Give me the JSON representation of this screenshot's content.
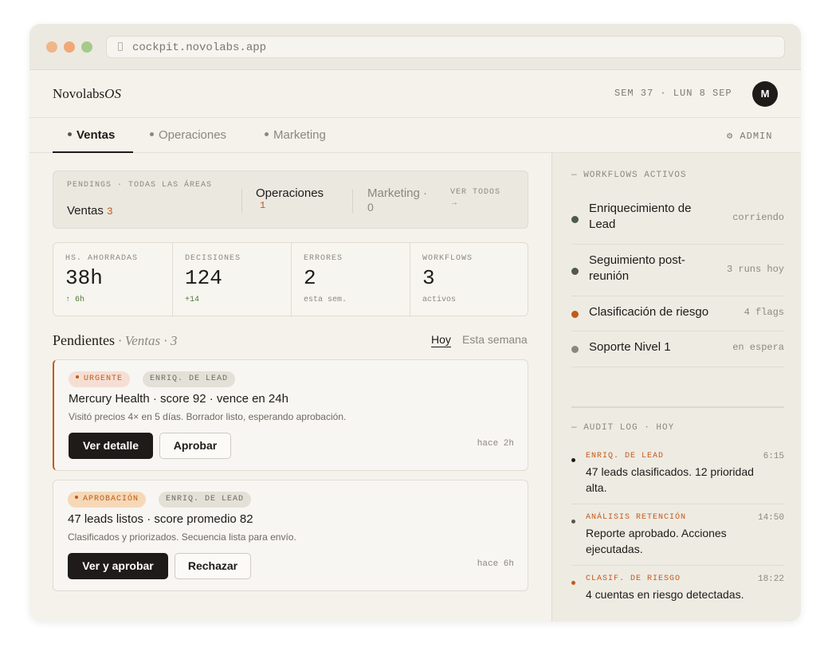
{
  "browser": {
    "url": "cockpit.novolabs.app"
  },
  "header": {
    "brand_main": "Novolabs",
    "brand_italic": "OS",
    "date": "SEM 37 · LUN 8 SEP",
    "avatar": "M"
  },
  "tabs": [
    {
      "label": "Ventas"
    },
    {
      "label": "Operaciones"
    },
    {
      "label": "Marketing"
    }
  ],
  "admin_label": "⚙ ADMIN",
  "pendings": {
    "caption": "PENDINGS · TODAS LAS ÁREAS",
    "ventas_label": "Ventas",
    "ventas_count": "3",
    "ops_label": "Operaciones",
    "ops_count": "1",
    "mkt_label": "Marketing ·",
    "mkt_count": "0",
    "ver_todos": "VER TODOS",
    "arrow": "→"
  },
  "stats": [
    {
      "label": "HS. AHORRADAS",
      "value": "38h",
      "sub": "↑ 6h"
    },
    {
      "label": "DECISIONES",
      "value": "124",
      "sub": "+14"
    },
    {
      "label": "ERRORES",
      "value": "2",
      "sub": "esta sem."
    },
    {
      "label": "WORKFLOWS",
      "value": "3",
      "sub": "activos"
    }
  ],
  "section": {
    "title": "Pendientes",
    "subtitle": " · Ventas · 3",
    "filter_today": "Hoy",
    "filter_week": "Esta semana"
  },
  "cards": [
    {
      "tag1": "URGENTE",
      "tag2": "ENRIQ. DE LEAD",
      "title": "Mercury Health · score 92 · vence en 24h",
      "desc": "Visitó precios 4× en 5 días. Borrador listo, esperando aprobación.",
      "btn_primary": "Ver detalle",
      "btn_secondary": "Aprobar",
      "time": "hace 2h"
    },
    {
      "tag1": "APROBACIÓN",
      "tag2": "ENRIQ. DE LEAD",
      "title": "47 leads listos · score promedio 82",
      "desc": "Clasificados y priorizados. Secuencia lista para envío.",
      "btn_primary": "Ver y aprobar",
      "btn_secondary": "Rechazar",
      "time": "hace 6h"
    }
  ],
  "workflows": {
    "heading": "— WORKFLOWS ACTIVOS",
    "items": [
      {
        "name": "Enriquecimiento de Lead",
        "status": "corriendo",
        "color": "#4e5b46"
      },
      {
        "name": "Seguimiento post-reunión",
        "status": "3 runs hoy",
        "color": "#4e5b46"
      },
      {
        "name": "Clasificación de riesgo",
        "status": "4 flags",
        "color": "#c25a1a"
      },
      {
        "name": "Soporte Nivel 1",
        "status": "en espera",
        "color": "#8c877e"
      }
    ]
  },
  "audit": {
    "heading": "— AUDIT LOG · HOY",
    "items": [
      {
        "category": "ENRIQ. DE LEAD",
        "time": "6:15",
        "text": "47 leads clasificados. 12 prioridad alta."
      },
      {
        "category": "ANÁLISIS RETENCIÓN",
        "time": "14:50",
        "text": "Reporte aprobado. Acciones ejecutadas."
      },
      {
        "category": "CLASIF. DE RIESGO",
        "time": "18:22",
        "text": "4 cuentas en riesgo detectadas."
      }
    ]
  }
}
